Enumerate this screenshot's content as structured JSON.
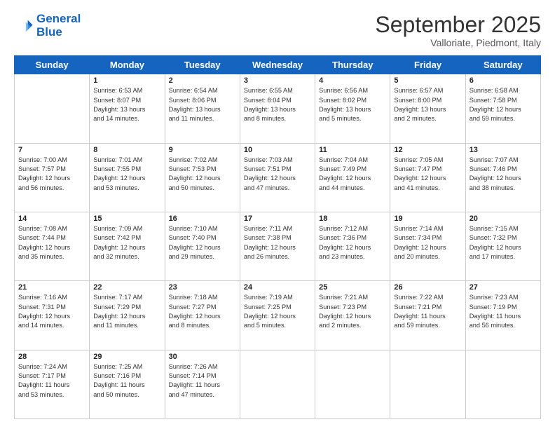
{
  "logo": {
    "line1": "General",
    "line2": "Blue"
  },
  "header": {
    "month": "September 2025",
    "location": "Valloriate, Piedmont, Italy"
  },
  "days_of_week": [
    "Sunday",
    "Monday",
    "Tuesday",
    "Wednesday",
    "Thursday",
    "Friday",
    "Saturday"
  ],
  "weeks": [
    [
      {
        "day": "",
        "text": ""
      },
      {
        "day": "1",
        "text": "Sunrise: 6:53 AM\nSunset: 8:07 PM\nDaylight: 13 hours\nand 14 minutes."
      },
      {
        "day": "2",
        "text": "Sunrise: 6:54 AM\nSunset: 8:06 PM\nDaylight: 13 hours\nand 11 minutes."
      },
      {
        "day": "3",
        "text": "Sunrise: 6:55 AM\nSunset: 8:04 PM\nDaylight: 13 hours\nand 8 minutes."
      },
      {
        "day": "4",
        "text": "Sunrise: 6:56 AM\nSunset: 8:02 PM\nDaylight: 13 hours\nand 5 minutes."
      },
      {
        "day": "5",
        "text": "Sunrise: 6:57 AM\nSunset: 8:00 PM\nDaylight: 13 hours\nand 2 minutes."
      },
      {
        "day": "6",
        "text": "Sunrise: 6:58 AM\nSunset: 7:58 PM\nDaylight: 12 hours\nand 59 minutes."
      }
    ],
    [
      {
        "day": "7",
        "text": "Sunrise: 7:00 AM\nSunset: 7:57 PM\nDaylight: 12 hours\nand 56 minutes."
      },
      {
        "day": "8",
        "text": "Sunrise: 7:01 AM\nSunset: 7:55 PM\nDaylight: 12 hours\nand 53 minutes."
      },
      {
        "day": "9",
        "text": "Sunrise: 7:02 AM\nSunset: 7:53 PM\nDaylight: 12 hours\nand 50 minutes."
      },
      {
        "day": "10",
        "text": "Sunrise: 7:03 AM\nSunset: 7:51 PM\nDaylight: 12 hours\nand 47 minutes."
      },
      {
        "day": "11",
        "text": "Sunrise: 7:04 AM\nSunset: 7:49 PM\nDaylight: 12 hours\nand 44 minutes."
      },
      {
        "day": "12",
        "text": "Sunrise: 7:05 AM\nSunset: 7:47 PM\nDaylight: 12 hours\nand 41 minutes."
      },
      {
        "day": "13",
        "text": "Sunrise: 7:07 AM\nSunset: 7:46 PM\nDaylight: 12 hours\nand 38 minutes."
      }
    ],
    [
      {
        "day": "14",
        "text": "Sunrise: 7:08 AM\nSunset: 7:44 PM\nDaylight: 12 hours\nand 35 minutes."
      },
      {
        "day": "15",
        "text": "Sunrise: 7:09 AM\nSunset: 7:42 PM\nDaylight: 12 hours\nand 32 minutes."
      },
      {
        "day": "16",
        "text": "Sunrise: 7:10 AM\nSunset: 7:40 PM\nDaylight: 12 hours\nand 29 minutes."
      },
      {
        "day": "17",
        "text": "Sunrise: 7:11 AM\nSunset: 7:38 PM\nDaylight: 12 hours\nand 26 minutes."
      },
      {
        "day": "18",
        "text": "Sunrise: 7:12 AM\nSunset: 7:36 PM\nDaylight: 12 hours\nand 23 minutes."
      },
      {
        "day": "19",
        "text": "Sunrise: 7:14 AM\nSunset: 7:34 PM\nDaylight: 12 hours\nand 20 minutes."
      },
      {
        "day": "20",
        "text": "Sunrise: 7:15 AM\nSunset: 7:32 PM\nDaylight: 12 hours\nand 17 minutes."
      }
    ],
    [
      {
        "day": "21",
        "text": "Sunrise: 7:16 AM\nSunset: 7:31 PM\nDaylight: 12 hours\nand 14 minutes."
      },
      {
        "day": "22",
        "text": "Sunrise: 7:17 AM\nSunset: 7:29 PM\nDaylight: 12 hours\nand 11 minutes."
      },
      {
        "day": "23",
        "text": "Sunrise: 7:18 AM\nSunset: 7:27 PM\nDaylight: 12 hours\nand 8 minutes."
      },
      {
        "day": "24",
        "text": "Sunrise: 7:19 AM\nSunset: 7:25 PM\nDaylight: 12 hours\nand 5 minutes."
      },
      {
        "day": "25",
        "text": "Sunrise: 7:21 AM\nSunset: 7:23 PM\nDaylight: 12 hours\nand 2 minutes."
      },
      {
        "day": "26",
        "text": "Sunrise: 7:22 AM\nSunset: 7:21 PM\nDaylight: 11 hours\nand 59 minutes."
      },
      {
        "day": "27",
        "text": "Sunrise: 7:23 AM\nSunset: 7:19 PM\nDaylight: 11 hours\nand 56 minutes."
      }
    ],
    [
      {
        "day": "28",
        "text": "Sunrise: 7:24 AM\nSunset: 7:17 PM\nDaylight: 11 hours\nand 53 minutes."
      },
      {
        "day": "29",
        "text": "Sunrise: 7:25 AM\nSunset: 7:16 PM\nDaylight: 11 hours\nand 50 minutes."
      },
      {
        "day": "30",
        "text": "Sunrise: 7:26 AM\nSunset: 7:14 PM\nDaylight: 11 hours\nand 47 minutes."
      },
      {
        "day": "",
        "text": ""
      },
      {
        "day": "",
        "text": ""
      },
      {
        "day": "",
        "text": ""
      },
      {
        "day": "",
        "text": ""
      }
    ]
  ]
}
